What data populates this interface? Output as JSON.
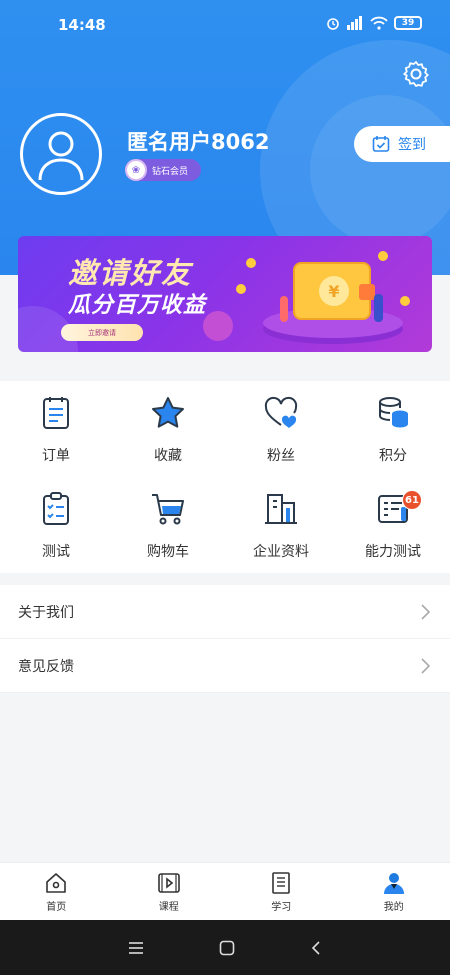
{
  "status_bar": {
    "time": "14:48",
    "battery": "39"
  },
  "profile": {
    "username": "匿名用户8062",
    "vip_label": "钻石会员",
    "checkin_label": "签到"
  },
  "banner": {
    "title_line1": "邀请好友",
    "title_line2": "瓜分百万收益",
    "button_label": "立即邀请"
  },
  "grid": {
    "items": [
      {
        "label": "订单",
        "icon": "order-icon"
      },
      {
        "label": "收藏",
        "icon": "star-icon"
      },
      {
        "label": "粉丝",
        "icon": "heart-fans-icon"
      },
      {
        "label": "积分",
        "icon": "coins-icon"
      },
      {
        "label": "测试",
        "icon": "clipboard-check-icon"
      },
      {
        "label": "购物车",
        "icon": "cart-icon"
      },
      {
        "label": "企业资料",
        "icon": "building-icon"
      },
      {
        "label": "能力测试",
        "icon": "ability-test-icon",
        "badge": "61"
      }
    ]
  },
  "list": {
    "items": [
      {
        "label": "关于我们"
      },
      {
        "label": "意见反馈"
      }
    ]
  },
  "bottom_nav": {
    "items": [
      {
        "label": "首页",
        "icon": "home-icon"
      },
      {
        "label": "课程",
        "icon": "course-icon"
      },
      {
        "label": "学习",
        "icon": "study-icon"
      },
      {
        "label": "我的",
        "icon": "profile-icon",
        "active": true
      }
    ]
  },
  "colors": {
    "primary": "#2a86ee",
    "badge": "#e8512c",
    "vip": "#7d5ce0"
  }
}
